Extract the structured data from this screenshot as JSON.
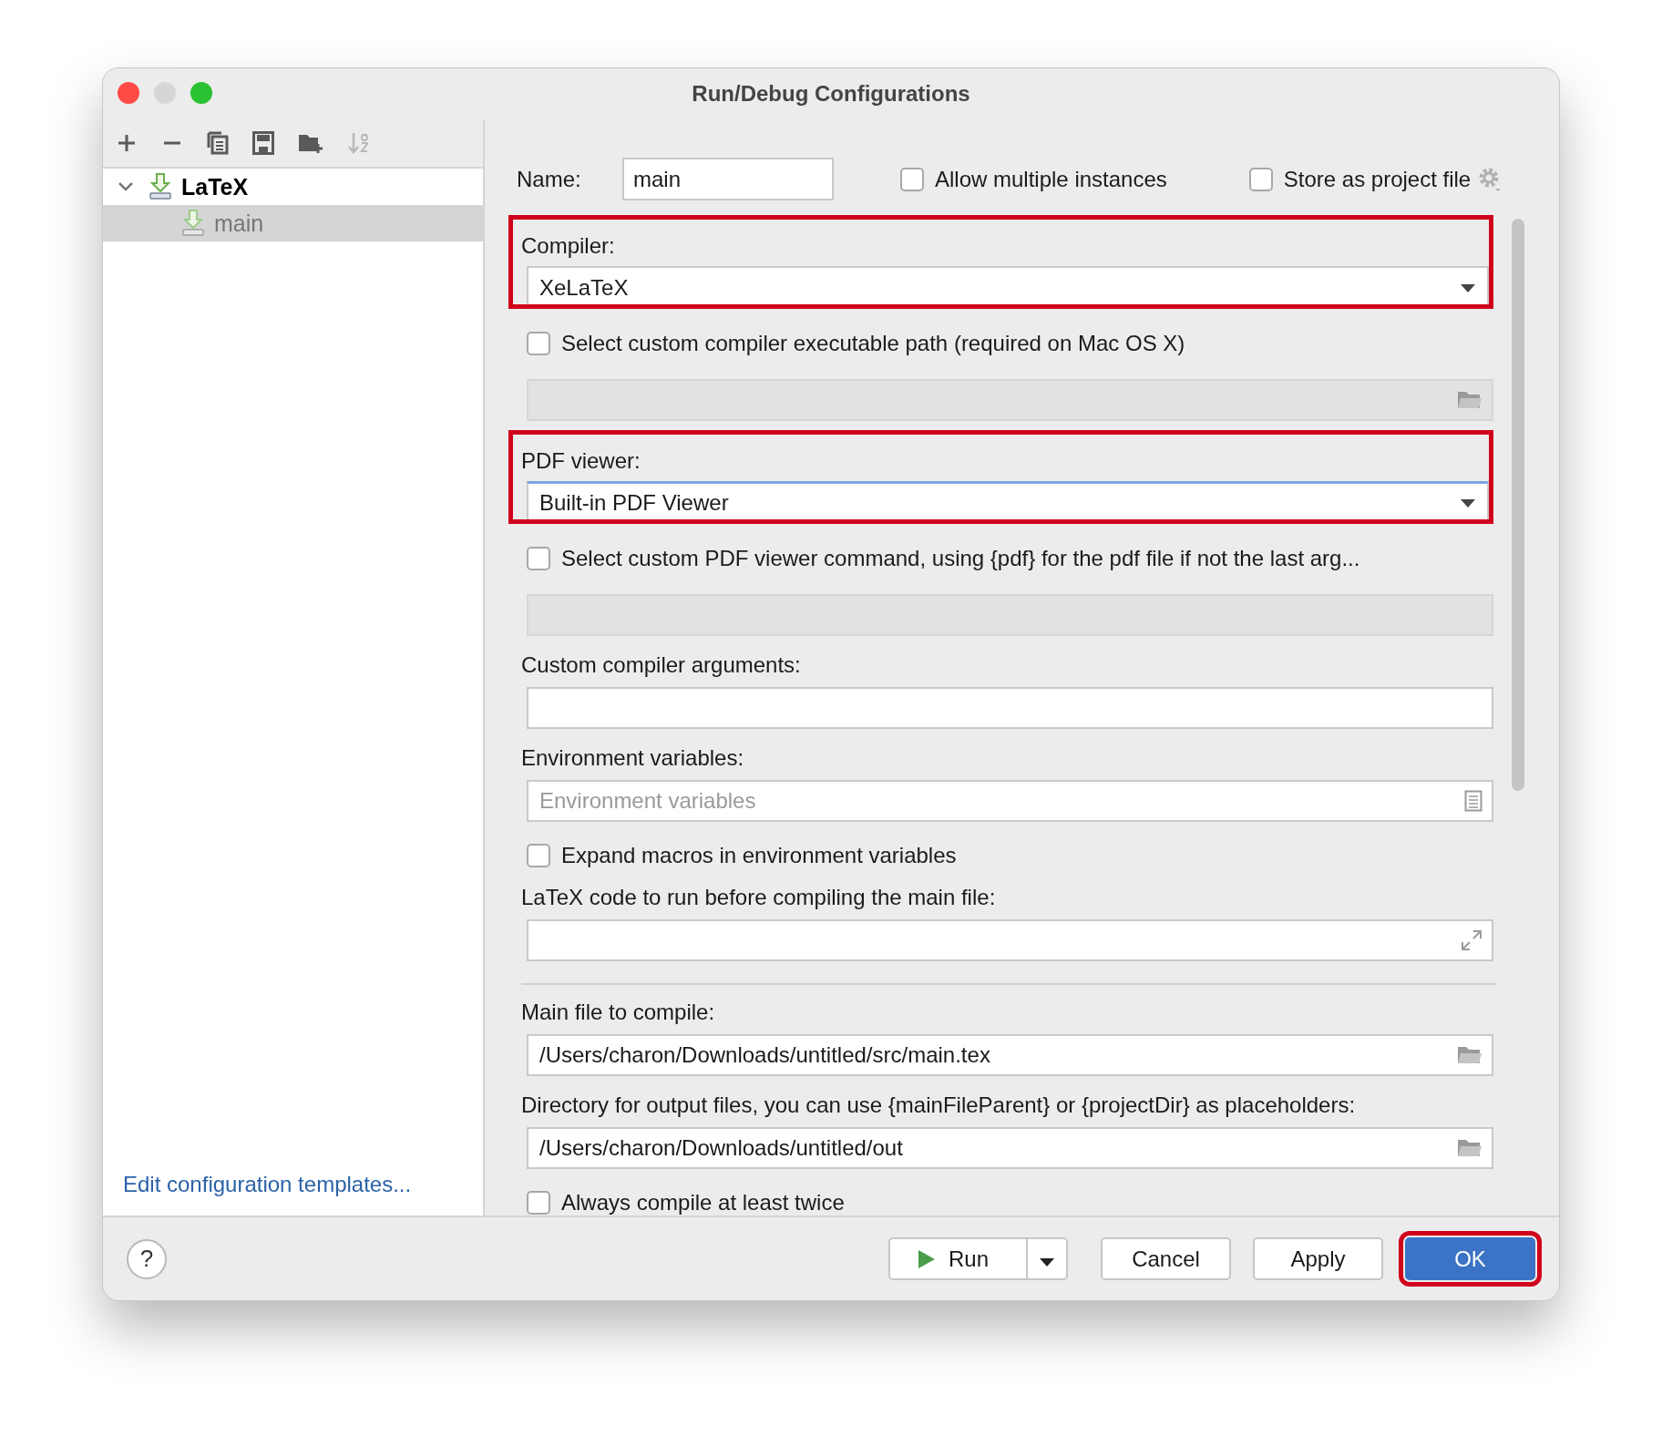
{
  "window": {
    "title": "Run/Debug Configurations"
  },
  "toolbar": [
    {
      "kind": "add",
      "disabled": false
    },
    {
      "kind": "remove",
      "disabled": false
    },
    {
      "kind": "copy",
      "disabled": false
    },
    {
      "kind": "save",
      "disabled": false
    },
    {
      "kind": "folder",
      "disabled": false
    },
    {
      "kind": "sort",
      "disabled": true
    }
  ],
  "tree": [
    {
      "label": "LaTeX",
      "expanded": true,
      "selected": false,
      "children": [
        {
          "label": "main",
          "selected": true
        }
      ]
    }
  ],
  "templates_link": "Edit configuration templates...",
  "name_field": {
    "label": "Name:",
    "value": "main"
  },
  "header_options": [
    {
      "label": "Allow multiple instances",
      "checked": false
    },
    {
      "label": "Store as project file",
      "checked": false
    }
  ],
  "form": [
    {
      "kind": "dropdown",
      "label": "Compiler:",
      "value": "XeLaTeX",
      "highlighted": true,
      "focused": false
    },
    {
      "kind": "checkbox",
      "label": "Select custom compiler executable path (required on Mac OS X)",
      "checked": false
    },
    {
      "kind": "field",
      "disabled": true,
      "trailing_button": {
        "kind": "folder"
      }
    },
    {
      "kind": "dropdown",
      "label": "PDF viewer:",
      "value": "Built-in PDF Viewer",
      "highlighted": true,
      "focused": true
    },
    {
      "kind": "checkbox",
      "label": "Select custom PDF viewer command, using {pdf} for the pdf file if not the last arg...",
      "checked": false
    },
    {
      "kind": "field",
      "disabled": true
    },
    {
      "kind": "field",
      "label": "Custom compiler arguments:",
      "disabled": false
    },
    {
      "kind": "field",
      "label": "Environment variables:",
      "placeholder": "Environment variables",
      "disabled": false,
      "trailing_button": {
        "kind": "list"
      }
    },
    {
      "kind": "checkbox",
      "label": "Expand macros in environment variables",
      "checked": false
    },
    {
      "kind": "field",
      "label": "LaTeX code to run before compiling the main file:",
      "disabled": false,
      "trailing_button": {
        "kind": "expand"
      }
    },
    {
      "kind": "separator"
    },
    {
      "kind": "field",
      "label": "Main file to compile:",
      "value": "/Users/charon/Downloads/untitled/src/main.tex",
      "disabled": false,
      "trailing_button": {
        "kind": "folder"
      }
    },
    {
      "kind": "field",
      "label": "Directory for output files, you can use {mainFileParent} or {projectDir} as placeholders:",
      "value": "/Users/charon/Downloads/untitled/out",
      "disabled": false,
      "trailing_button": {
        "kind": "folder"
      }
    },
    {
      "kind": "checkbox",
      "label": "Always compile at least twice",
      "checked": false
    }
  ],
  "help": "?",
  "buttons": [
    {
      "kind": "run",
      "label": "Run",
      "default": false,
      "highlighted": false
    },
    {
      "kind": "plain",
      "label": "Cancel",
      "default": false,
      "highlighted": false
    },
    {
      "kind": "plain",
      "label": "Apply",
      "default": false,
      "highlighted": false
    },
    {
      "kind": "plain",
      "label": "OK",
      "default": true,
      "highlighted": true
    }
  ]
}
